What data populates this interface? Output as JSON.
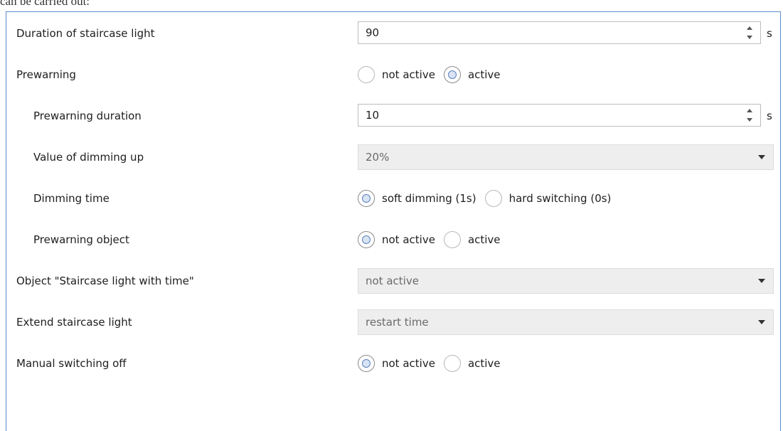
{
  "header_text": "can be carried out:",
  "rows": [
    {
      "label": "Duration of staircase light",
      "value": "90",
      "unit": "s"
    },
    {
      "label": "Prewarning",
      "options": [
        "not active",
        "active"
      ],
      "selected": "active"
    },
    {
      "label": "Prewarning duration",
      "value": "10",
      "unit": "s"
    },
    {
      "label": "Value of dimming up",
      "value": "20%"
    },
    {
      "label": "Dimming time",
      "options": [
        "soft dimming (1s)",
        "hard switching (0s)"
      ],
      "selected": "soft dimming (1s)"
    },
    {
      "label": "Prewarning object",
      "options": [
        "not active",
        "active"
      ],
      "selected": "not active"
    },
    {
      "label": "Object \"Staircase light with time\"",
      "value": "not active"
    },
    {
      "label": "Extend staircase light",
      "value": "restart time"
    },
    {
      "label": "Manual switching off",
      "options": [
        "not active",
        "active"
      ],
      "selected": "not active"
    }
  ]
}
